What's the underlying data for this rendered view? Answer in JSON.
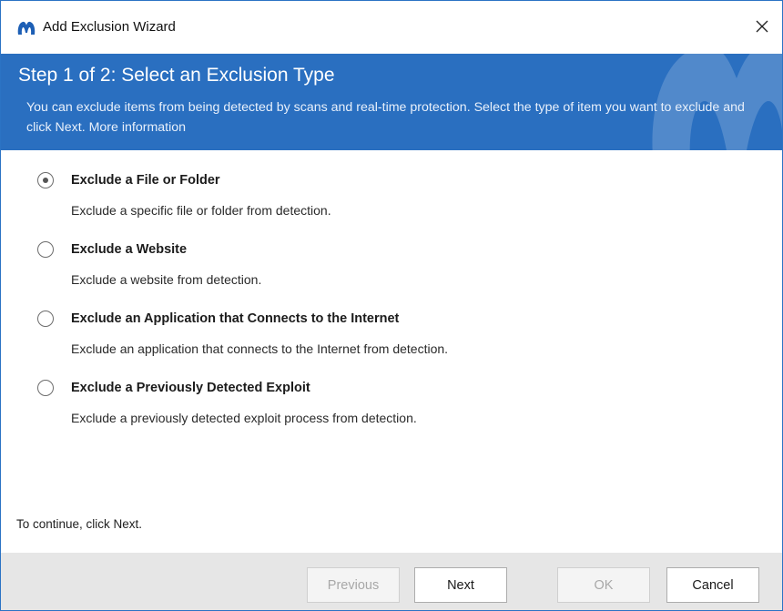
{
  "window": {
    "title": "Add Exclusion Wizard",
    "close_icon": "close-icon",
    "app_icon": "malwarebytes-logo-icon",
    "accent_color": "#2a6fc0"
  },
  "header": {
    "title": "Step 1 of 2: Select an Exclusion Type",
    "description": "You can exclude items from being detected by scans and real-time protection. Select the type of item you want to exclude and click Next.",
    "more_info_link": "More information"
  },
  "options": [
    {
      "title": "Exclude a File or Folder",
      "description": "Exclude a specific file or folder from detection.",
      "selected": true
    },
    {
      "title": "Exclude a Website",
      "description": "Exclude a website from detection.",
      "selected": false
    },
    {
      "title": "Exclude an Application that Connects to the Internet",
      "description": "Exclude an application that connects to the Internet from detection.",
      "selected": false
    },
    {
      "title": "Exclude a Previously Detected Exploit",
      "description": "Exclude a previously detected exploit process from detection.",
      "selected": false
    }
  ],
  "continue_text": "To continue, click Next.",
  "footer": {
    "previous_label": "Previous",
    "next_label": "Next",
    "ok_label": "OK",
    "cancel_label": "Cancel"
  }
}
